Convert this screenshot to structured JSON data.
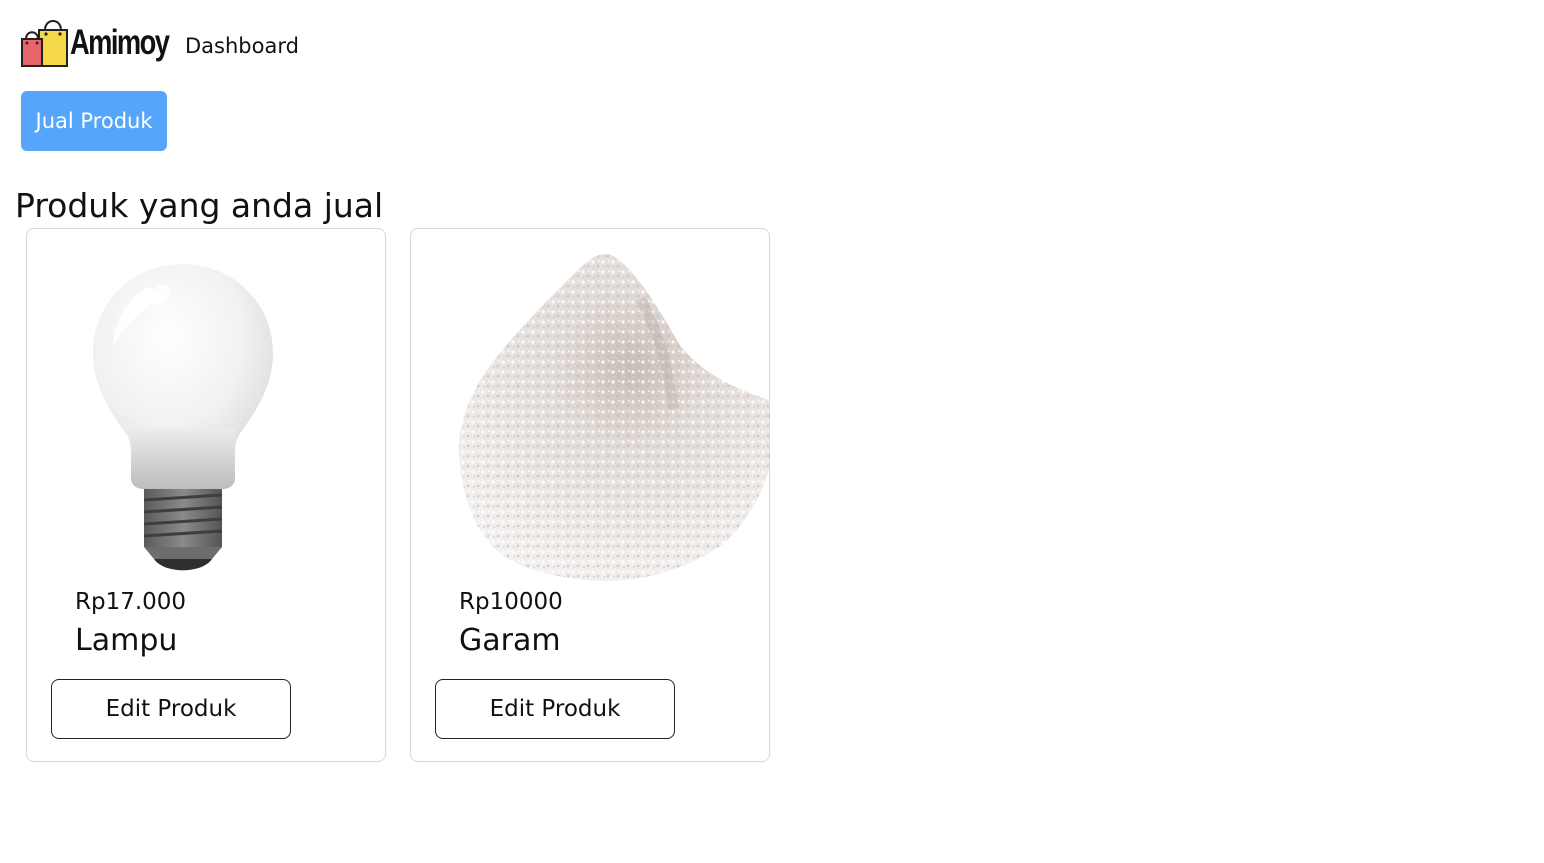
{
  "header": {
    "brand": "Amimoy",
    "page": "Dashboard",
    "logo_icon": "shopping-bags-icon"
  },
  "actions": {
    "sell_label": "Jual Produk",
    "sell_color": "#55a6fb"
  },
  "products_section": {
    "title": "Produk yang anda jual",
    "items": [
      {
        "image_icon": "light-bulb-image",
        "price": "Rp17.000",
        "name": "Lampu",
        "edit_label": "Edit Produk"
      },
      {
        "image_icon": "salt-pile-image",
        "price": "Rp10000",
        "name": "Garam",
        "edit_label": "Edit Produk"
      }
    ]
  }
}
